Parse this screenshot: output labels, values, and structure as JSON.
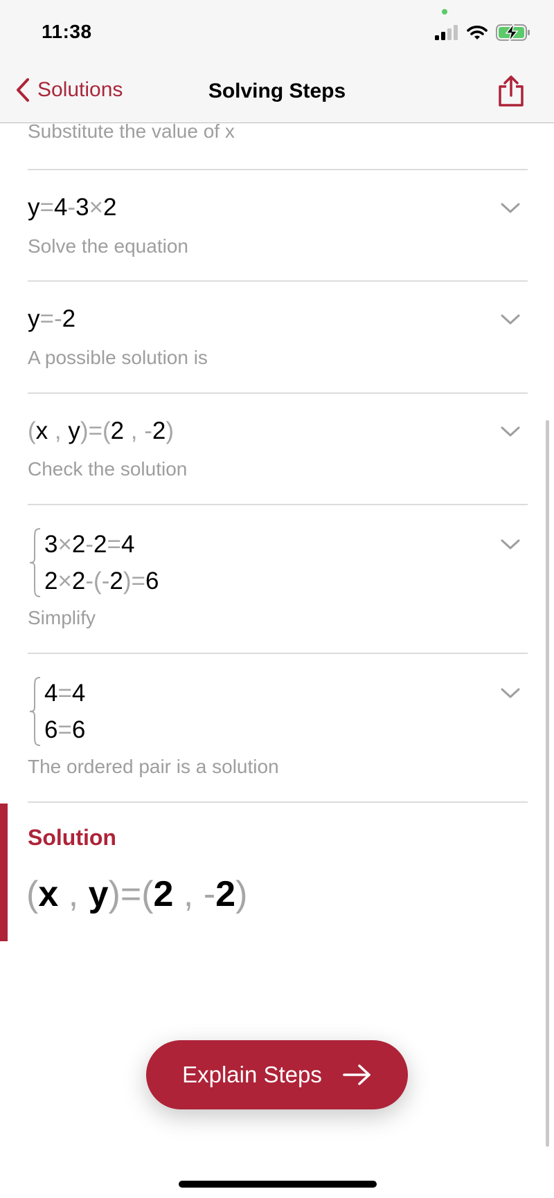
{
  "status_bar": {
    "time": "11:38",
    "icons": [
      "signal-icon",
      "wifi-icon",
      "battery-charging-icon"
    ],
    "battery_color": "#5cc96a"
  },
  "nav": {
    "back_label": "Solutions",
    "title": "Solving Steps",
    "share_icon": "share-icon",
    "accent_color": "#ae2338"
  },
  "partial_step": {
    "description": "Substitute the value of x"
  },
  "steps": [
    {
      "math_parts": [
        [
          "y",
          ""
        ],
        [
          "=",
          "op"
        ],
        [
          "4",
          ""
        ],
        [
          "-",
          "op"
        ],
        [
          "3",
          ""
        ],
        [
          "×",
          "op"
        ],
        [
          "2",
          ""
        ]
      ],
      "description": "Solve the equation"
    },
    {
      "math_parts": [
        [
          "y",
          ""
        ],
        [
          "=",
          "op"
        ],
        [
          "-",
          "op"
        ],
        [
          "2",
          ""
        ]
      ],
      "description": "A possible solution is"
    },
    {
      "math_parts": [
        [
          "(",
          "op"
        ],
        [
          "x",
          ""
        ],
        [
          " , ",
          "op"
        ],
        [
          "y",
          ""
        ],
        [
          ")",
          "op"
        ],
        [
          "=",
          "op"
        ],
        [
          "(",
          "op"
        ],
        [
          "2",
          ""
        ],
        [
          " , ",
          "op"
        ],
        [
          "-",
          "op"
        ],
        [
          "2",
          ""
        ],
        [
          ")",
          "op"
        ]
      ],
      "description": "Check the solution"
    },
    {
      "system_lines": [
        [
          [
            "3",
            ""
          ],
          [
            "×",
            "op"
          ],
          [
            "2",
            ""
          ],
          [
            "-",
            "op"
          ],
          [
            "2",
            ""
          ],
          [
            "=",
            "op"
          ],
          [
            "4",
            ""
          ]
        ],
        [
          [
            "2",
            ""
          ],
          [
            "×",
            "op"
          ],
          [
            "2",
            ""
          ],
          [
            "-",
            "op"
          ],
          [
            "(",
            "op"
          ],
          [
            "-",
            "op"
          ],
          [
            "2",
            ""
          ],
          [
            ")",
            "op"
          ],
          [
            "=",
            "op"
          ],
          [
            "6",
            ""
          ]
        ]
      ],
      "description": "Simplify"
    },
    {
      "system_lines": [
        [
          [
            "4",
            ""
          ],
          [
            "=",
            "op"
          ],
          [
            "4",
            ""
          ]
        ],
        [
          [
            "6",
            ""
          ],
          [
            "=",
            "op"
          ],
          [
            "6",
            ""
          ]
        ]
      ],
      "description": "The ordered pair is a solution"
    }
  ],
  "solution": {
    "title": "Solution",
    "math_parts": [
      [
        "(",
        "op"
      ],
      [
        "x",
        ""
      ],
      [
        " , ",
        "op"
      ],
      [
        "y",
        ""
      ],
      [
        ")",
        "op"
      ],
      [
        "=",
        "op"
      ],
      [
        "(",
        "op"
      ],
      [
        "2",
        ""
      ],
      [
        " , ",
        "op"
      ],
      [
        "-",
        "op"
      ],
      [
        "2",
        ""
      ],
      [
        ")",
        "op"
      ]
    ]
  },
  "explain_button": {
    "label": "Explain Steps",
    "icon": "arrow-right-icon"
  }
}
